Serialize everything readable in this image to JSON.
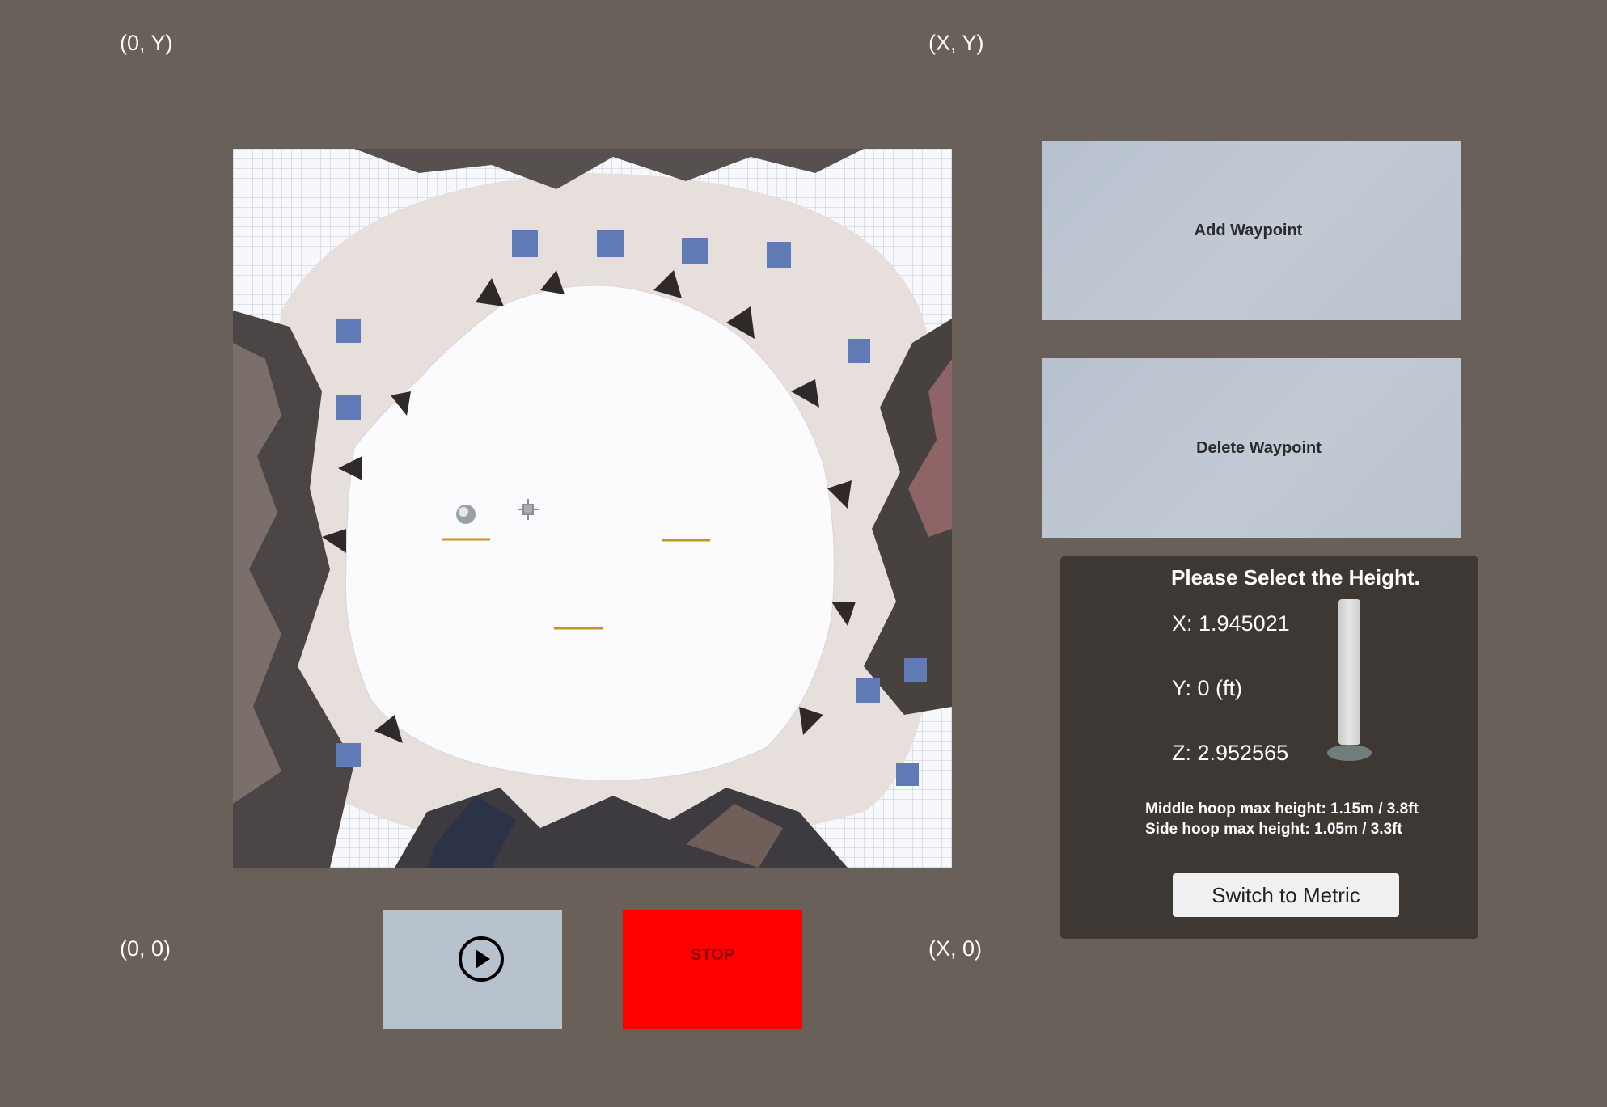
{
  "corner_labels": {
    "top_left": "(0, Y)",
    "top_right": "(X, Y)",
    "bottom_left": "(0, 0)",
    "bottom_right": "(X, 0)"
  },
  "buttons": {
    "add_waypoint": "Add Waypoint",
    "delete_waypoint": "Delete Waypoint",
    "play_icon": "play-circle-icon",
    "stop": "STOP"
  },
  "height_panel": {
    "title": "Please Select the Height.",
    "x": "X: 1.945021",
    "y": "Y: 0 (ft)",
    "z": "Z: 2.952565",
    "slider_level": 0,
    "middle_hoop": "Middle hoop max height: 1.15m / 3.8ft",
    "side_hoop": "Side hoop max height: 1.05m / 3.3ft",
    "switch_button": "Switch to Metric"
  },
  "colors": {
    "background": "#686059",
    "button_gray": "#b8c2cd",
    "stop_red": "#ff0000",
    "panel_dark": "#3e3835"
  }
}
